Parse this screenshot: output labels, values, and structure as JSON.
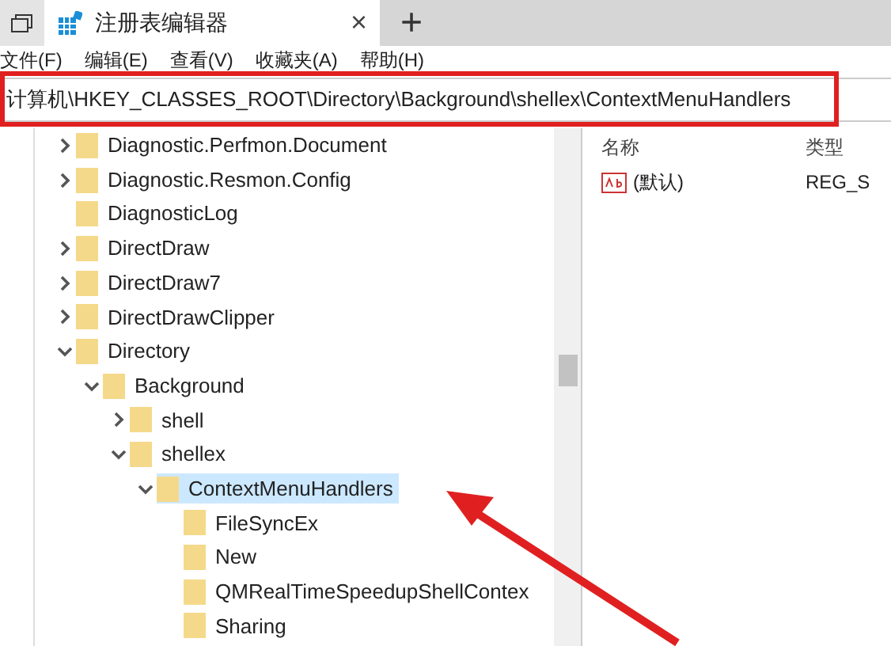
{
  "tab": {
    "title": "注册表编辑器",
    "close": "×",
    "new_tab": "+"
  },
  "menu": [
    "文件(F)",
    "编辑(E)",
    "查看(V)",
    "收藏夹(A)",
    "帮助(H)"
  ],
  "address": "计算机\\HKEY_CLASSES_ROOT\\Directory\\Background\\shellex\\ContextMenuHandlers",
  "tree": [
    {
      "label": "Diagnostic.Perfmon.Document",
      "expanded": false,
      "selected": false
    },
    {
      "label": "Diagnostic.Resmon.Config",
      "expanded": false,
      "selected": false
    },
    {
      "label": "DiagnosticLog",
      "selected": false
    },
    {
      "label": "DirectDraw",
      "expanded": false,
      "selected": false
    },
    {
      "label": "DirectDraw7",
      "expanded": false,
      "selected": false
    },
    {
      "label": "DirectDrawClipper",
      "expanded": false,
      "selected": false
    },
    {
      "label": "Directory",
      "expanded": true,
      "selected": false,
      "children": [
        {
          "label": "Background",
          "expanded": true,
          "selected": false,
          "children": [
            {
              "label": "shell",
              "expanded": false,
              "selected": false
            },
            {
              "label": "shellex",
              "expanded": true,
              "selected": false,
              "children": [
                {
                  "label": "ContextMenuHandlers",
                  "expanded": true,
                  "selected": true,
                  "children": [
                    {
                      "label": "FileSyncEx",
                      "selected": false
                    },
                    {
                      "label": "New",
                      "selected": false
                    },
                    {
                      "label": "QMRealTimeSpeedupShellContex",
                      "selected": false
                    },
                    {
                      "label": "Sharing",
                      "selected": false
                    }
                  ]
                }
              ]
            }
          ]
        }
      ]
    }
  ],
  "values": {
    "columns": [
      "名称",
      "类型"
    ],
    "rows": [
      {
        "name": "(默认)",
        "type": "REG_S"
      }
    ]
  }
}
